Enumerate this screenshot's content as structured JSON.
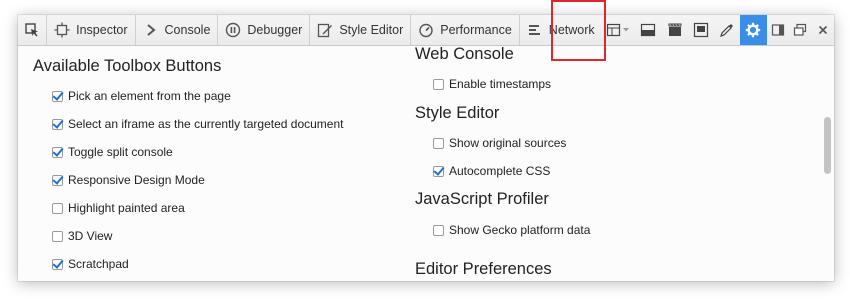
{
  "toolbar": {
    "tabs": [
      {
        "label": "Inspector",
        "icon": "inspector-icon"
      },
      {
        "label": "Console",
        "icon": "console-icon"
      },
      {
        "label": "Debugger",
        "icon": "debugger-icon"
      },
      {
        "label": "Style Editor",
        "icon": "style-editor-icon"
      },
      {
        "label": "Performance",
        "icon": "performance-icon"
      },
      {
        "label": "Network",
        "icon": "network-icon"
      }
    ],
    "accent": "#3b8ee8",
    "highlight_color": "#e0262b"
  },
  "left": {
    "heading": "Available Toolbox Buttons",
    "options": [
      {
        "label": "Pick an element from the page",
        "checked": true
      },
      {
        "label": "Select an iframe as the currently targeted document",
        "checked": true
      },
      {
        "label": "Toggle split console",
        "checked": true
      },
      {
        "label": "Responsive Design Mode",
        "checked": true
      },
      {
        "label": "Highlight painted area",
        "checked": false
      },
      {
        "label": "3D View",
        "checked": false
      },
      {
        "label": "Scratchpad",
        "checked": true
      }
    ]
  },
  "right": {
    "web_console": {
      "heading": "Web Console",
      "options": [
        {
          "label": "Enable timestamps",
          "checked": false
        }
      ]
    },
    "style_editor": {
      "heading": "Style Editor",
      "options": [
        {
          "label": "Show original sources",
          "checked": false
        },
        {
          "label": "Autocomplete CSS",
          "checked": true
        }
      ]
    },
    "profiler": {
      "heading": "JavaScript Profiler",
      "options": [
        {
          "label": "Show Gecko platform data",
          "checked": false
        }
      ]
    },
    "editor_prefs": {
      "heading": "Editor Preferences"
    }
  }
}
